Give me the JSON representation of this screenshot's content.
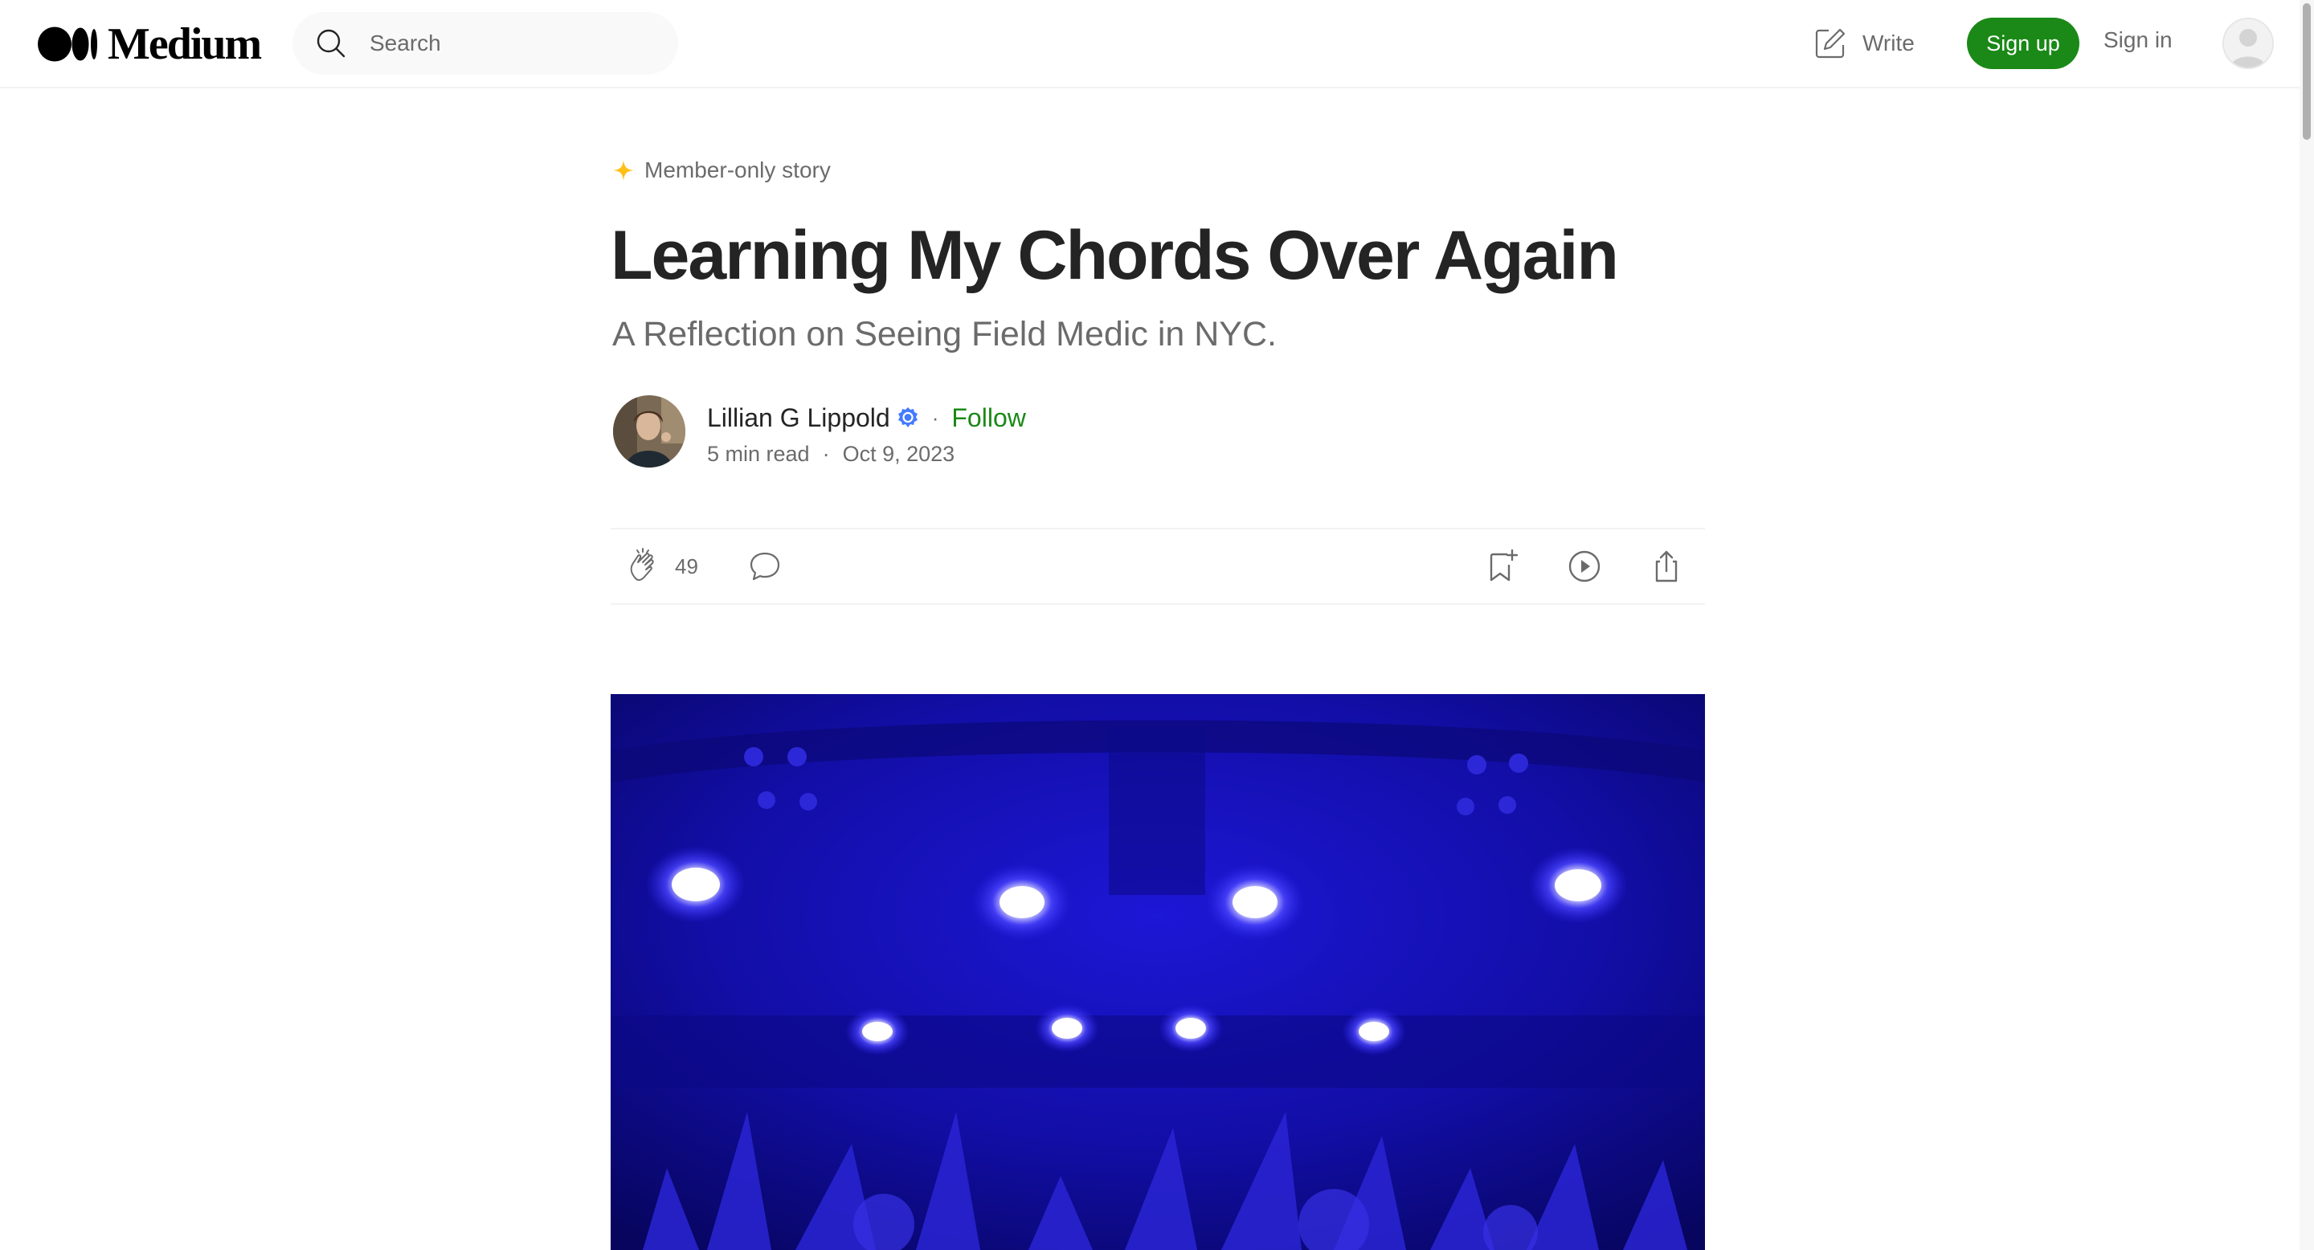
{
  "header": {
    "brand": "Medium",
    "search_placeholder": "Search",
    "write_label": "Write",
    "signup_label": "Sign up",
    "signin_label": "Sign in"
  },
  "article": {
    "member_label": "Member-only story",
    "title": "Learning My Chords Over Again",
    "subtitle": "A Reflection on Seeing Field Medic in NYC.",
    "author": {
      "name": "Lillian G Lippold",
      "follow_label": "Follow",
      "read_time": "5 min read",
      "date": "Oct 9, 2023"
    },
    "actions": {
      "clap_count": "49"
    }
  },
  "colors": {
    "accent_green": "#1a8917",
    "text_primary": "#242424",
    "text_secondary": "#6b6b6b",
    "star_gold": "#ffc017",
    "badge_blue": "#437aff",
    "hero_blue": "#1a14c8"
  },
  "icons": {
    "logo": "medium-logo-icon",
    "search": "search-icon",
    "write": "write-icon",
    "member": "star-icon",
    "verified": "verified-badge-icon",
    "clap": "clap-icon",
    "comment": "comment-icon",
    "bookmark": "bookmark-add-icon",
    "listen": "play-icon",
    "share": "share-icon"
  }
}
